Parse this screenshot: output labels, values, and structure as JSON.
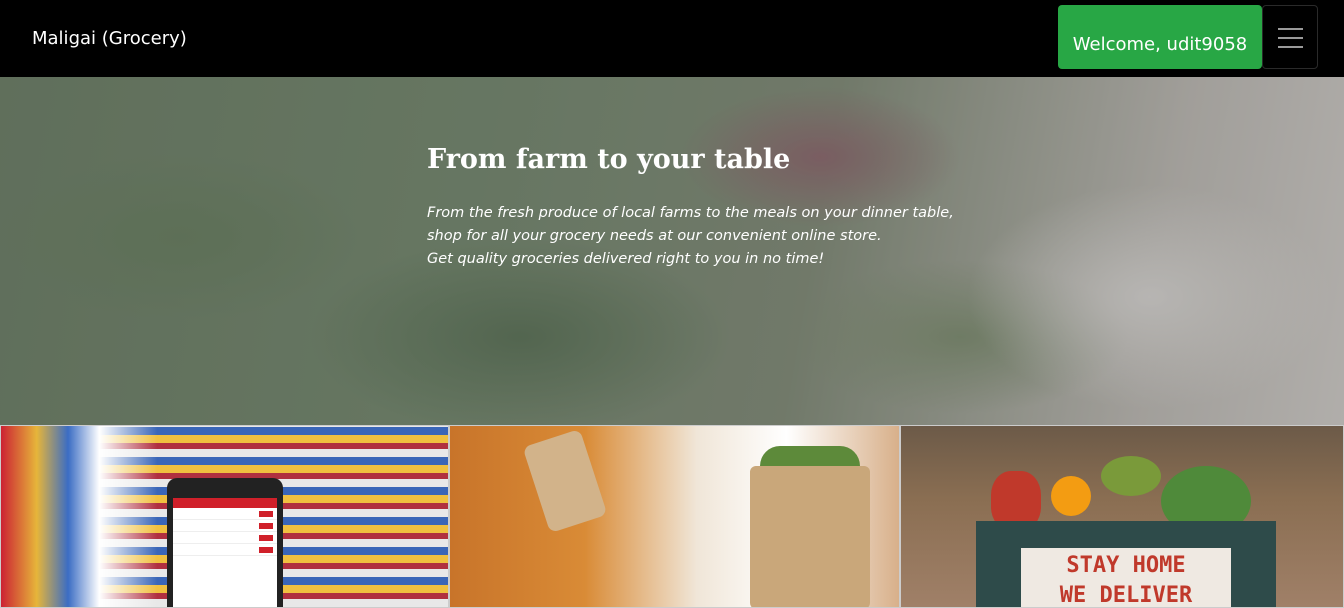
{
  "navbar": {
    "brand": "Maligai (Grocery)",
    "welcome": "Welcome, udit9058",
    "toggler_icon": "hamburger-menu-icon",
    "background": "#000000",
    "accent": "#28a745"
  },
  "hero": {
    "title": "From farm to your table",
    "lines": [
      "From the fresh produce of local farms to the meals on your dinner table,",
      "shop for all your grocery needs at our convenient online store.",
      "Get quality groceries delivered right to you in no time!"
    ]
  },
  "tiles": {
    "delivery_sign": [
      "STAY HOME",
      "WE DELIVER"
    ]
  }
}
